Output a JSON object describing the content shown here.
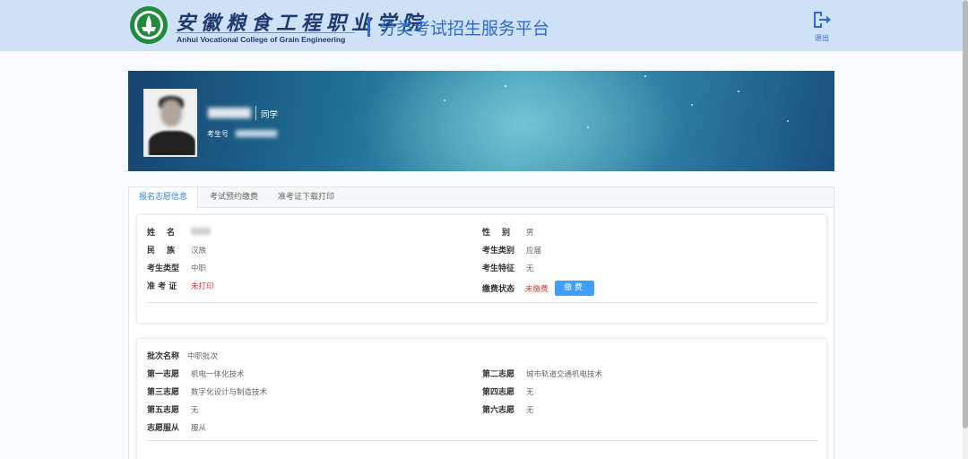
{
  "header": {
    "school_name_cn": "安徽粮食工程职业学院",
    "school_name_en": "Anhui Vocational College of Grain Engineering",
    "platform_title": "分类考试招生服务平台",
    "logout_label": "退出"
  },
  "profile": {
    "greeting_suffix": "同学",
    "exam_no_label": "考生号"
  },
  "tabs": [
    {
      "label": "报名志愿信息",
      "active": true
    },
    {
      "label": "考试预约缴费",
      "active": false
    },
    {
      "label": "准考证下载打印",
      "active": false
    }
  ],
  "basic_info": {
    "name_label": "姓　名",
    "gender_label": "性　别",
    "gender_value": "男",
    "ethnicity_label": "民　族",
    "ethnicity_value": "汉族",
    "category_label": "考生类别",
    "category_value": "应届",
    "type_label": "考生类型",
    "type_value": "中职",
    "feature_label": "考生特征",
    "feature_value": "无",
    "admission_label": "准 考 证",
    "admission_value": "未打印",
    "payment_label": "缴费状态",
    "payment_value": "未缴费",
    "pay_button": "缴费"
  },
  "volunteer_info": {
    "batch_label": "批次名称",
    "batch_value": "中职批次",
    "choice1_label": "第一志愿",
    "choice1_value": "机电一体化技术",
    "choice2_label": "第二志愿",
    "choice2_value": "城市轨道交通机电技术",
    "choice3_label": "第三志愿",
    "choice3_value": "数字化设计与制造技术",
    "choice4_label": "第四志愿",
    "choice4_value": "无",
    "choice5_label": "第五志愿",
    "choice5_value": "无",
    "choice6_label": "第六志愿",
    "choice6_value": "无",
    "obey_label": "志愿服从",
    "obey_value": "服从"
  },
  "colors": {
    "header_bg": "#cfe1f7",
    "accent": "#2e6bd1",
    "tab_active": "#2e86de",
    "pay_button": "#409eff",
    "warning_red": "#e53935"
  },
  "icons": {
    "logo": "school-emblem-icon",
    "logout": "logout-arrow-icon"
  }
}
